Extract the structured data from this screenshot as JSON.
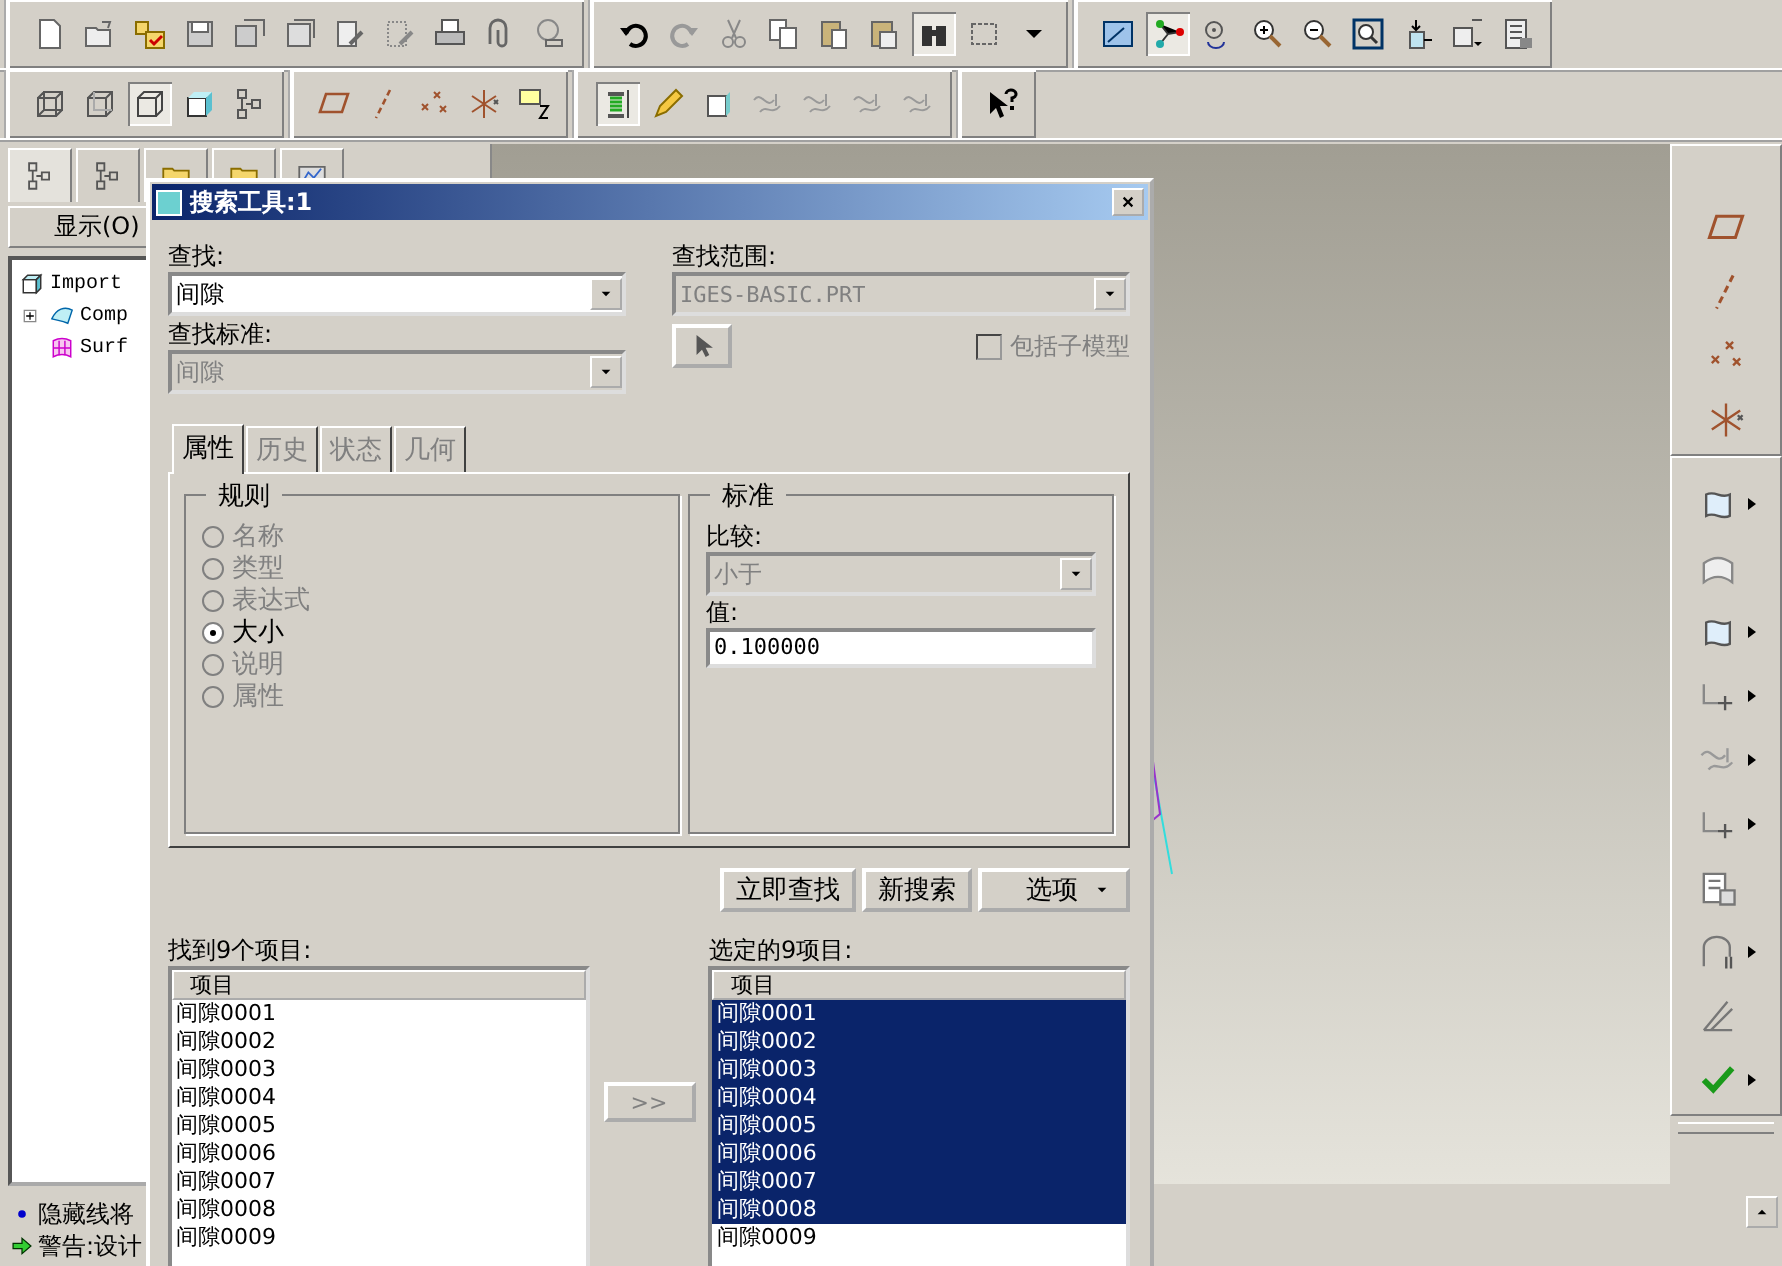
{
  "model_tree": {
    "menu_label": "显示(O)",
    "items": [
      {
        "label": "Import",
        "kind": "part",
        "children": [
          {
            "label": "Comp",
            "kind": "quilt"
          },
          {
            "label": "Surf",
            "kind": "surface"
          }
        ]
      }
    ]
  },
  "messages": [
    {
      "kind": "info",
      "text": "隐藏线将"
    },
    {
      "kind": "warning",
      "text": "警告:设计"
    }
  ],
  "dialog": {
    "title": "搜索工具:1",
    "find": {
      "label": "查找:",
      "value": "间隙",
      "disabled": false
    },
    "look_in": {
      "label": "查找范围:",
      "value": "IGES-BASIC.PRT",
      "disabled": true
    },
    "criteria": {
      "label": "查找标准:",
      "value": "间隙",
      "disabled": true
    },
    "include_submodels": {
      "label": "包括子模型",
      "checked": false,
      "disabled": true
    },
    "tabs": [
      {
        "label": "属性",
        "selected": true,
        "disabled": false
      },
      {
        "label": "历史",
        "selected": false,
        "disabled": true
      },
      {
        "label": "状态",
        "selected": false,
        "disabled": true
      },
      {
        "label": "几何",
        "selected": false,
        "disabled": true
      }
    ],
    "rules": {
      "title": "规则",
      "options": [
        {
          "label": "名称",
          "selected": false,
          "disabled": true
        },
        {
          "label": "类型",
          "selected": false,
          "disabled": true
        },
        {
          "label": "表达式",
          "selected": false,
          "disabled": true
        },
        {
          "label": "大小",
          "selected": true,
          "disabled": false
        },
        {
          "label": "说明",
          "selected": false,
          "disabled": true
        },
        {
          "label": "属性",
          "selected": false,
          "disabled": true
        }
      ]
    },
    "criteria_group": {
      "title": "标准",
      "compare": {
        "label": "比较:",
        "value": "小于",
        "disabled": true
      },
      "value": {
        "label": "值:",
        "value": "0.100000"
      }
    },
    "buttons": [
      {
        "label": "立即查找",
        "kind": "plain"
      },
      {
        "label": "新搜索",
        "kind": "plain"
      },
      {
        "label": "选项",
        "kind": "menu"
      }
    ],
    "found": {
      "label": "找到9个项目:",
      "column": "项目",
      "items": [
        {
          "text": "间隙0001",
          "selected": false
        },
        {
          "text": "间隙0002",
          "selected": false
        },
        {
          "text": "间隙0003",
          "selected": false
        },
        {
          "text": "间隙0004",
          "selected": false
        },
        {
          "text": "间隙0005",
          "selected": false
        },
        {
          "text": "间隙0006",
          "selected": false
        },
        {
          "text": "间隙0007",
          "selected": false
        },
        {
          "text": "间隙0008",
          "selected": false
        },
        {
          "text": "间隙0009",
          "selected": false
        }
      ]
    },
    "transfer_button": {
      "label": ">>",
      "disabled": true
    },
    "chosen": {
      "label": "选定的9项目:",
      "column": "项目",
      "items": [
        {
          "text": "间隙0001",
          "selected": true
        },
        {
          "text": "间隙0002",
          "selected": true
        },
        {
          "text": "间隙0003",
          "selected": true
        },
        {
          "text": "间隙0004",
          "selected": true
        },
        {
          "text": "间隙0005",
          "selected": true
        },
        {
          "text": "间隙0006",
          "selected": true
        },
        {
          "text": "间隙0007",
          "selected": true
        },
        {
          "text": "间隙0008",
          "selected": true
        },
        {
          "text": "间隙0009",
          "selected": false
        }
      ]
    }
  }
}
